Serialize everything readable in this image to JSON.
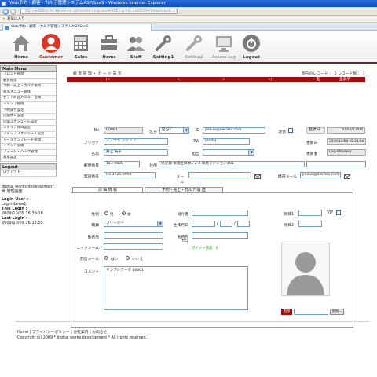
{
  "browser": {
    "title": "Web予約・顧客・カルテ管理システムASP/SaaS - Windows Internet Explorer",
    "url": "http://webtb07r0.dw-server.com/admin/cap-bn/webtb.cgi?m=customerinfo&fe(&id=1 &act=info&t=&lb=d&ph_customer=&modi0",
    "favorites_label": "お気に入り",
    "tab_label": "Web予約・顧客・カルテ管理システムASP/SaaS"
  },
  "toolbar": {
    "items": [
      {
        "label": "Home",
        "icon": "home-icon"
      },
      {
        "label": "Customer",
        "icon": "customer-icon"
      },
      {
        "label": "Sales",
        "icon": "sales-icon"
      },
      {
        "label": "Items",
        "icon": "items-icon"
      },
      {
        "label": "Staff",
        "icon": "staff-icon"
      },
      {
        "label": "Setting1",
        "icon": "setting1-icon"
      },
      {
        "label": "Setting2",
        "icon": "setting2-icon"
      },
      {
        "label": "Access Log",
        "icon": "access-log-icon"
      },
      {
        "label": "Logout",
        "icon": "logout-icon"
      }
    ],
    "accent": "#a60b0b"
  },
  "sidebar": {
    "main_menu_label": "Main Menu",
    "items": [
      "フロント管理",
      "顧客管理",
      "予約・売上・カルテ管理",
      "商品メニュー管理",
      "セット商品メニュー管理",
      "スタッフ管理",
      "予約受付設定",
      "店舗休日設定",
      "店舗スケジュール設定",
      "スタッフ休日設定",
      "スタッフスケジュール設定",
      "メールテンプレート管理",
      "イベント管理",
      "フィード・ハック管理",
      "基本設定"
    ],
    "logout_label": "Logout",
    "logout_items": [
      "ログアウト"
    ],
    "company": "digital works development 様 管理画面",
    "login_user_label": "Login User :",
    "login_user": "LoginName1",
    "this_login_label": "This Login :",
    "this_login": "2009/10/09 16:39:18",
    "last_login_label": "Last Login :",
    "last_login": "2009/10/09 16:12:55"
  },
  "main": {
    "breadcrumb": "顧 客 管 理 ・ カ ー ド 表 示",
    "record_info": "現在のレコード ： 1 レコード数 ： 1",
    "redbar": {
      "first": "|<",
      "prev": "<",
      "next": ">",
      "last": ">|",
      "list": "一覧",
      "all": "全表示"
    },
    "form": {
      "no_label": "No",
      "no": "00001",
      "category_label": "区分",
      "category": "区分2",
      "id_label": "ID",
      "id": "jinoue@dwrdev.com",
      "withdrawn_label": "退会",
      "registered_label": "登録日",
      "registered": "2003/11/04",
      "kana_label": "フリガナ",
      "kana": "イノウエ ジュンコ",
      "pw_label": "PW",
      "pw": "00001",
      "updated_label": "更新日",
      "updated": "2009/10/09 15:34:54",
      "name_label": "名前",
      "name": "井上 純子",
      "person_label": "担当",
      "updater_label": "更新者",
      "updater": "LoginName1",
      "zip_label": "郵便番号",
      "zip": "153-0000",
      "address_label": "住所",
      "address": "東京都 目黒区目黒1-2-3 目黒マンション101",
      "phone_label": "電話番号",
      "phone": "03-3725-9999",
      "mail_label": "メール",
      "mobile_mail_label": "携帯メール",
      "mobile_mail": "jinoue@dwrdev.com"
    },
    "tabs": [
      "詳 細 情 報",
      "予約・売上・カルテ 履 歴"
    ],
    "detail": {
      "gender_label": "性別",
      "gender_male": "男",
      "gender_female": "女",
      "occupation_label": "職業",
      "occupation": "フリーター",
      "workplace_label": "勤務先",
      "nickname_label": "ニックネーム",
      "mail_consent_label": "配信メール",
      "yes": "はい",
      "no": "いいえ",
      "comment_label": "コメント",
      "comment": "サンプルデータ 00001",
      "introducer_label": "紹介者",
      "birthday_label": "生年月日",
      "work_tel_label": "勤務先TEL",
      "points_label": "ポイント残高 : 0",
      "custom1_label": "項目1",
      "vip_label": "VIP",
      "custom2_label": "項目2",
      "photo_delete": "削除",
      "photo_browse": "参照..."
    }
  },
  "footer": {
    "links": "Home | プライバシーポリシー | 会社案内 | お問合せ",
    "copyright": "Copyright (c) 2009 * digital works development * All rights reserved."
  }
}
